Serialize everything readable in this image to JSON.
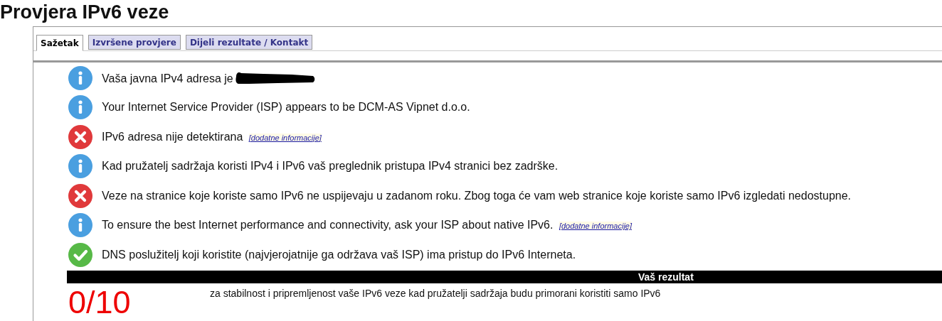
{
  "page_title": "Provjera IPv6 veze",
  "tabs": [
    {
      "label": "Sažetak",
      "selected": true
    },
    {
      "label": "Izvršene provjere",
      "selected": false
    },
    {
      "label": "Dijeli rezultate / Kontakt",
      "selected": false
    }
  ],
  "checks": [
    {
      "kind": "info",
      "text": "Vaša javna IPv4 adresa je",
      "redacted": true
    },
    {
      "kind": "info",
      "text": "Your Internet Service Provider (ISP) appears to be DCM-AS Vipnet d.o.o."
    },
    {
      "kind": "error",
      "text": "IPv6 adresa nije detektirana",
      "link": "[dodatne informacije]"
    },
    {
      "kind": "info",
      "text": "Kad pružatelj sadržaja koristi IPv4 i IPv6 vaš preglednik pristupa IPv4 stranici bez zadrške."
    },
    {
      "kind": "error",
      "text": "Veze na stranice koje koriste samo IPv6 ne uspijevaju u zadanom roku. Zbog toga će vam web stranice koje koriste samo IPv6 izgledati nedostupne."
    },
    {
      "kind": "info",
      "text": "To ensure the best Internet performance and connectivity, ask your ISP about native IPv6.",
      "link": "[dodatne informacije]"
    },
    {
      "kind": "ok",
      "text": "DNS poslužitelj koji koristite (najvjerojatnije ga održava vaš ISP) ima pristup do IPv6 Interneta."
    }
  ],
  "result": {
    "heading": "Vaš rezultat",
    "score": "0/10",
    "description": "za stabilnost i pripremljenost vaše IPv6 veze kad pružatelji sadržaja budu primorani koristiti samo IPv6"
  }
}
